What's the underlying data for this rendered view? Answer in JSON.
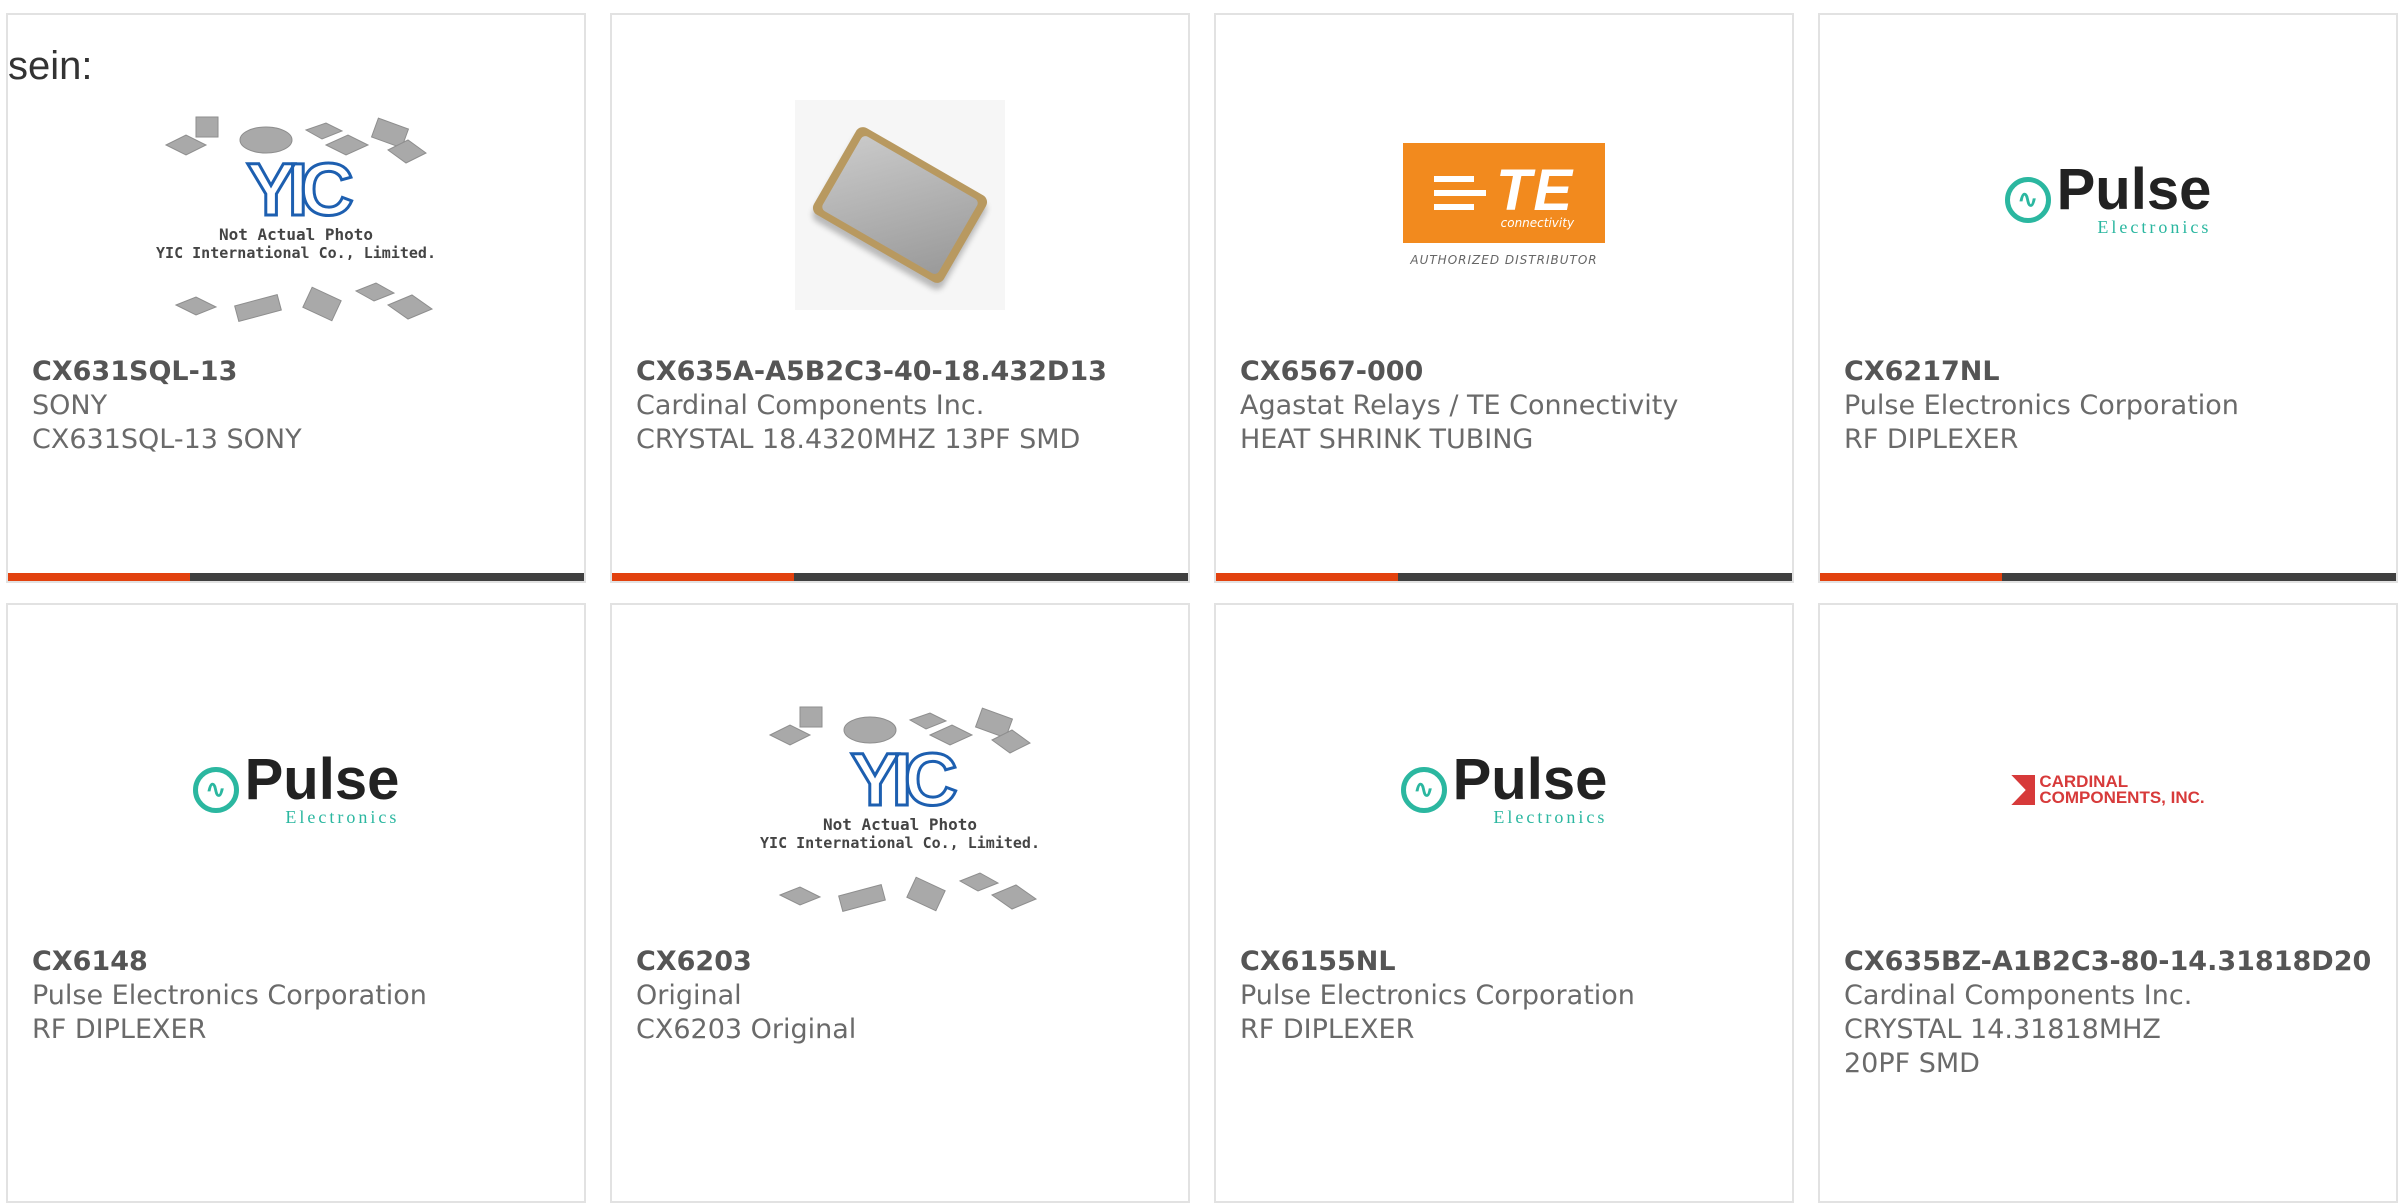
{
  "intro_text": "sein:",
  "colors": {
    "accent": "#e2410e",
    "bar": "#3f3f3f",
    "border": "#e2e2e2"
  },
  "products": [
    {
      "part_number": "CX631SQL-13",
      "manufacturer": "SONY",
      "description": "CX631SQL-13 SONY",
      "image": "placeholder",
      "image_text": {
        "mark": "YIC",
        "line1": "Not Actual Photo",
        "line2": "YIC International Co., Limited."
      }
    },
    {
      "part_number": "CX635A-A5B2C3-40-18.432D13",
      "manufacturer": "Cardinal Components Inc.",
      "description": "CRYSTAL 18.4320MHZ 13PF SMD",
      "image": "crystal"
    },
    {
      "part_number": "CX6567-000",
      "manufacturer": "Agastat Relays / TE Connectivity",
      "description": "HEAT SHRINK TUBING",
      "image": "te-logo",
      "image_text": {
        "mark": "TE",
        "sub": "connectivity",
        "caption": "AUTHORIZED DISTRIBUTOR"
      }
    },
    {
      "part_number": "CX6217NL",
      "manufacturer": "Pulse Electronics Corporation",
      "description": "RF DIPLEXER",
      "image": "pulse-logo",
      "image_text": {
        "mark": "Pulse",
        "sub": "Electronics"
      }
    },
    {
      "part_number": "CX6148",
      "manufacturer": "Pulse Electronics Corporation",
      "description": "RF DIPLEXER",
      "image": "pulse-logo",
      "image_text": {
        "mark": "Pulse",
        "sub": "Electronics"
      }
    },
    {
      "part_number": "CX6203",
      "manufacturer": "Original",
      "description": "CX6203 Original",
      "image": "placeholder",
      "image_text": {
        "mark": "YIC",
        "line1": "Not Actual Photo",
        "line2": "YIC International Co., Limited."
      }
    },
    {
      "part_number": "CX6155NL",
      "manufacturer": "Pulse Electronics Corporation",
      "description": "RF DIPLEXER",
      "image": "pulse-logo",
      "image_text": {
        "mark": "Pulse",
        "sub": "Electronics"
      }
    },
    {
      "part_number": "CX635BZ-A1B2C3-80-14.31818D20",
      "manufacturer": "Cardinal Components Inc.",
      "description": "CRYSTAL 14.31818MHZ 20PF SMD",
      "image": "cardinal-logo",
      "image_text": {
        "line1": "CARDINAL",
        "line2": "COMPONENTS, INC."
      }
    }
  ]
}
